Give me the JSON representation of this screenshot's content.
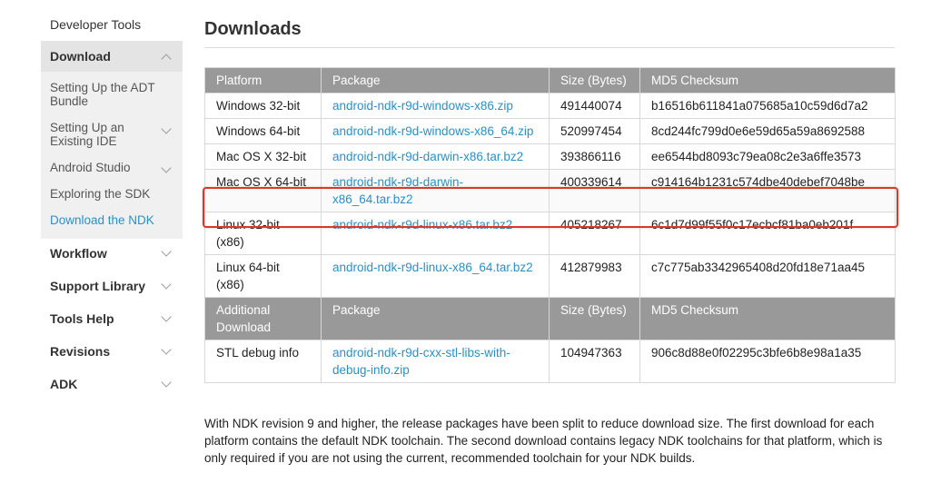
{
  "sidebar": {
    "top_label": "Developer Tools",
    "group": {
      "label": "Download",
      "items": [
        {
          "label": "Setting Up the ADT Bundle"
        },
        {
          "label": "Setting Up an Existing IDE"
        },
        {
          "label": "Android Studio"
        },
        {
          "label": "Exploring the SDK"
        },
        {
          "label": "Download the NDK"
        }
      ]
    },
    "sections": [
      {
        "label": "Workflow"
      },
      {
        "label": "Support Library"
      },
      {
        "label": "Tools Help"
      },
      {
        "label": "Revisions"
      },
      {
        "label": "ADK"
      }
    ]
  },
  "main": {
    "title": "Downloads",
    "headers": {
      "platform": "Platform",
      "package": "Package",
      "size": "Size (Bytes)",
      "md5": "MD5 Checksum"
    },
    "rows": [
      {
        "platform": "Windows 32-bit",
        "package": "android-ndk-r9d-windows-x86.zip",
        "size": "491440074",
        "md5": "b16516b611841a075685a10c59d6d7a2"
      },
      {
        "platform": "Windows 64-bit",
        "package": "android-ndk-r9d-windows-x86_64.zip",
        "size": "520997454",
        "md5": "8cd244fc799d0e6e59d65a59a8692588"
      },
      {
        "platform": "Mac OS X 32-bit",
        "package": "android-ndk-r9d-darwin-x86.tar.bz2",
        "size": "393866116",
        "md5": "ee6544bd8093c79ea08c2e3a6ffe3573"
      },
      {
        "platform": "Mac OS X 64-bit",
        "package": "android-ndk-r9d-darwin-x86_64.tar.bz2",
        "size": "400339614",
        "md5": "c914164b1231c574dbe40debef7048be"
      },
      {
        "platform": "Linux 32-bit (x86)",
        "package": "android-ndk-r9d-linux-x86.tar.bz2",
        "size": "405218267",
        "md5": "6c1d7d99f55f0c17ecbcf81ba0eb201f"
      },
      {
        "platform": "Linux 64-bit (x86)",
        "package": "android-ndk-r9d-linux-x86_64.tar.bz2",
        "size": "412879983",
        "md5": "c7c775ab3342965408d20fd18e71aa45"
      }
    ],
    "headers2": {
      "platform": "Additional Download",
      "package": "Package",
      "size": "Size (Bytes)",
      "md5": "MD5 Checksum"
    },
    "rows2": [
      {
        "platform": "STL debug info",
        "package": "android-ndk-r9d-cxx-stl-libs-with-debug-info.zip",
        "size": "104947363",
        "md5": "906c8d88e0f02295c3bfe6b8e98a1a35"
      }
    ],
    "note": "With NDK revision 9 and higher, the release packages have been split to reduce download size. The first download for each platform contains the default NDK toolchain. The second download contains legacy NDK toolchains for that platform, which is only required if you are not using the current, recommended toolchain for your NDK builds."
  },
  "colors": {
    "link": "#2a90c7",
    "header_bg": "#999999",
    "highlight": "#d9392c"
  }
}
